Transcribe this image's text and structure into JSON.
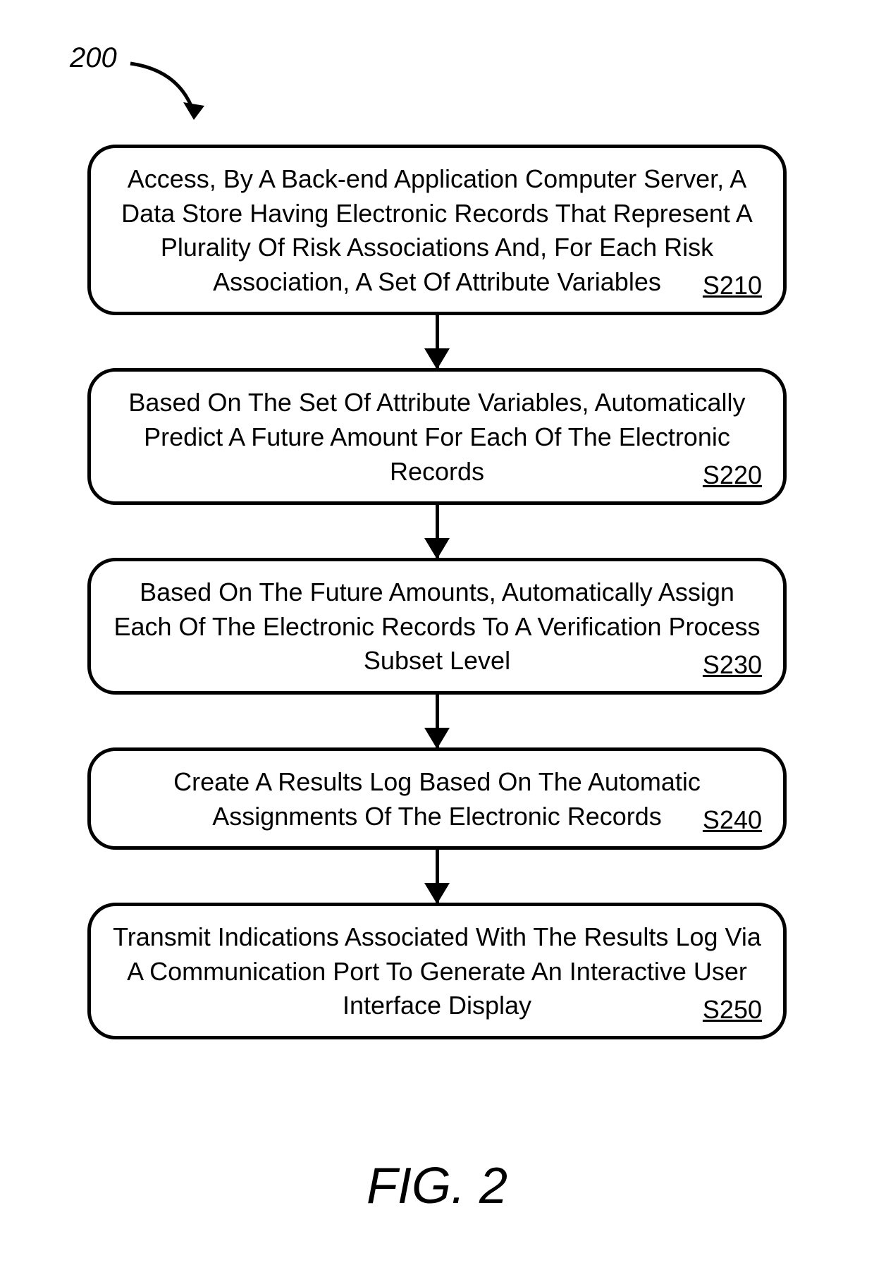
{
  "reference_number": "200",
  "figure_label": "FIG. 2",
  "steps": [
    {
      "text": "Access, By A Back-end Application Computer Server, A Data Store Having Electronic Records That Represent A Plurality Of Risk Associations And, For Each Risk Association, A Set Of Attribute Variables",
      "label": "S210"
    },
    {
      "text": "Based On The Set Of Attribute Variables, Automatically Predict A Future Amount For Each Of The Electronic Records",
      "label": "S220"
    },
    {
      "text": "Based On The Future Amounts, Automatically Assign Each Of The Electronic Records To A Verification Process Subset Level",
      "label": "S230"
    },
    {
      "text": "Create A Results Log Based On The Automatic Assignments Of The Electronic Records",
      "label": "S240"
    },
    {
      "text": "Transmit Indications Associated With The Results Log Via A Communication Port To Generate An Interactive User Interface Display",
      "label": "S250"
    }
  ]
}
